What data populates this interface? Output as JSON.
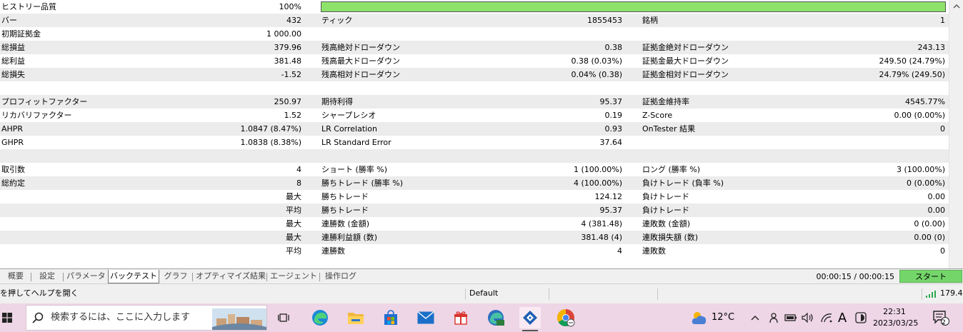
{
  "report": {
    "rows": [
      {
        "c1": "ヒストリー品質",
        "v1": "100%",
        "c2": "",
        "v2": "",
        "c3": "",
        "v3": ""
      },
      {
        "c1": "バー",
        "v1": "432",
        "c2": "ティック",
        "v2": "1855453",
        "c3": "銘柄",
        "v3": "1"
      },
      {
        "c1": "初期証拠金",
        "v1": "1 000.00",
        "c2": "",
        "v2": "",
        "c3": "",
        "v3": ""
      },
      {
        "c1": "総損益",
        "v1": "379.96",
        "c2": "残高絶対ドローダウン",
        "v2": "0.38",
        "c3": "証拠金絶対ドローダウン",
        "v3": "243.13"
      },
      {
        "c1": "総利益",
        "v1": "381.48",
        "c2": "残高最大ドローダウン",
        "v2": "0.38 (0.03%)",
        "c3": "証拠金最大ドローダウン",
        "v3": "249.50 (24.79%)"
      },
      {
        "c1": "総損失",
        "v1": "-1.52",
        "c2": "残高相対ドローダウン",
        "v2": "0.04% (0.38)",
        "c3": "証拠金相対ドローダウン",
        "v3": "24.79% (249.50)"
      },
      {
        "c1": "",
        "v1": "",
        "c2": "",
        "v2": "",
        "c3": "",
        "v3": ""
      },
      {
        "c1": "プロフィットファクター",
        "v1": "250.97",
        "c2": "期待利得",
        "v2": "95.37",
        "c3": "証拠金維持率",
        "v3": "4545.77%"
      },
      {
        "c1": "リカバリファクター",
        "v1": "1.52",
        "c2": "シャープレシオ",
        "v2": "0.19",
        "c3": "Z-Score",
        "v3": "0.00 (0.00%)"
      },
      {
        "c1": "AHPR",
        "v1": "1.0847 (8.47%)",
        "c2": "LR Correlation",
        "v2": "0.93",
        "c3": "OnTester 結果",
        "v3": "0"
      },
      {
        "c1": "GHPR",
        "v1": "1.0838 (8.38%)",
        "c2": "LR Standard Error",
        "v2": "37.64",
        "c3": "",
        "v3": ""
      },
      {
        "c1": "",
        "v1": "",
        "c2": "",
        "v2": "",
        "c3": "",
        "v3": ""
      },
      {
        "c1": "取引数",
        "v1": "4",
        "c2": "ショート (勝率 %)",
        "v2": "1 (100.00%)",
        "c3": "ロング (勝率 %)",
        "v3": "3 (100.00%)"
      },
      {
        "c1": "総約定",
        "v1": "8",
        "c2": "勝ちトレード (勝率 %)",
        "v2": "4 (100.00%)",
        "c3": "負けトレード (負率 %)",
        "v3": "0 (0.00%)"
      },
      {
        "c1": "",
        "v1": "最大",
        "c2": "勝ちトレード",
        "v2": "124.12",
        "c3": "負けトレード",
        "v3": "0.00"
      },
      {
        "c1": "",
        "v1": "平均",
        "c2": "勝ちトレード",
        "v2": "95.37",
        "c3": "負けトレード",
        "v3": "0.00"
      },
      {
        "c1": "",
        "v1": "最大",
        "c2": "連勝数 (金額)",
        "v2": "4 (381.48)",
        "c3": "連敗数 (金額)",
        "v3": "0 (0.00)"
      },
      {
        "c1": "",
        "v1": "最大",
        "c2": "連勝利益額 (数)",
        "v2": "381.48 (4)",
        "c3": "連敗損失額 (数)",
        "v3": "0.00 (0)"
      },
      {
        "c1": "",
        "v1": "平均",
        "c2": "連勝数",
        "v2": "4",
        "c3": "連敗数",
        "v3": "0"
      }
    ],
    "quality_bar_fraction": 1.0,
    "quality_bar_color": "#8ee26a"
  },
  "tabs": [
    "概要",
    "設定",
    "パラメータ",
    "バックテスト",
    "グラフ",
    "オプティマイズ結果",
    "エージェント",
    "操作ログ"
  ],
  "active_tab": "バックテスト",
  "timer": "00:00:15 / 00:00:15",
  "start_button": "スタート",
  "statusbar": {
    "help": "を押してヘルプを開く",
    "profile": "Default",
    "ping": "179.4"
  },
  "taskbar": {
    "search_placeholder": "検索するには、ここに入力します",
    "temperature": "12°C",
    "ime": "A",
    "time": "22:31",
    "date": "2023/03/25",
    "notification_count": "2",
    "icons": [
      "windows-start-icon",
      "search-icon",
      "task-view-icon",
      "edge-icon",
      "file-explorer-icon",
      "microsoft-store-icon",
      "mail-icon",
      "gift-app-icon",
      "edge-dev-icon",
      "metaeditor-icon",
      "chrome-icon"
    ]
  }
}
